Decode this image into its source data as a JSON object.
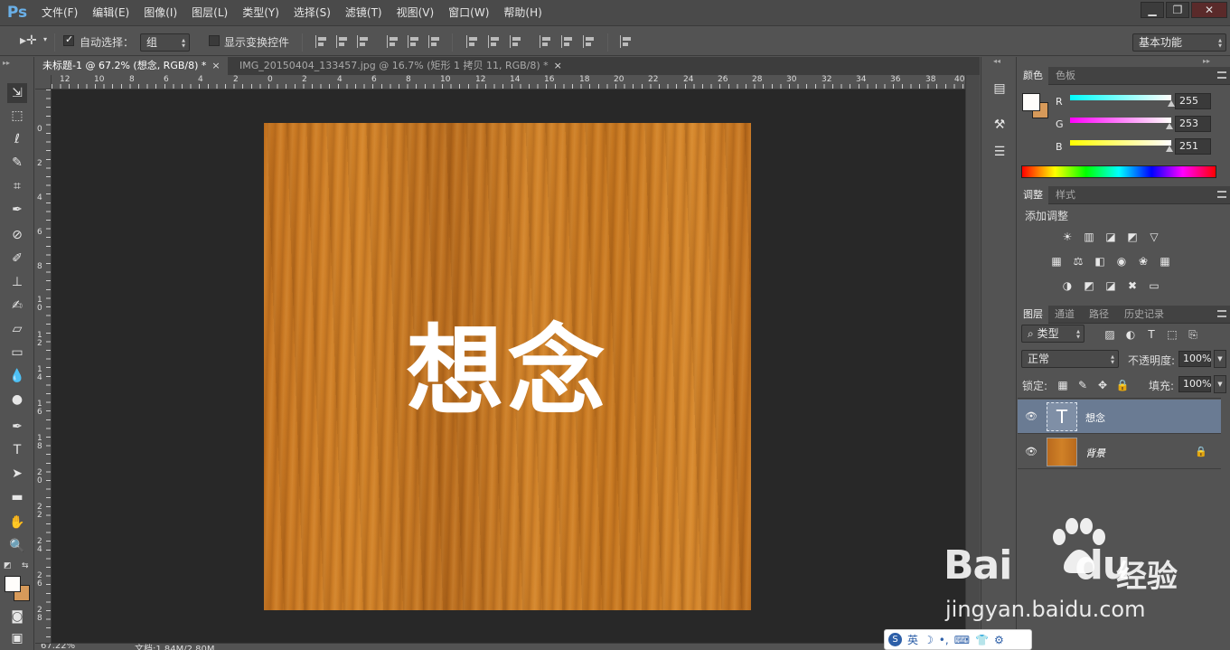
{
  "app": {
    "logo": "Ps"
  },
  "menu": [
    "文件(F)",
    "编辑(E)",
    "图像(I)",
    "图层(L)",
    "类型(Y)",
    "选择(S)",
    "滤镜(T)",
    "视图(V)",
    "窗口(W)",
    "帮助(H)"
  ],
  "window_buttons": {
    "minimize": "▁",
    "restore": "❐",
    "close": "✕"
  },
  "options": {
    "auto_select_label": "自动选择：",
    "auto_select_checked": true,
    "auto_select_target": "组",
    "show_transform_label": "显示变换控件",
    "show_transform_checked": false,
    "workspace": "基本功能"
  },
  "tabs": [
    {
      "label": "未标题-1 @ 67.2% (想念, RGB/8) *",
      "active": true
    },
    {
      "label": "IMG_20150404_133457.jpg @ 16.7% (矩形 1 拷贝 11, RGB/8) *",
      "active": false
    }
  ],
  "ruler": {
    "h_labels": [
      "12",
      "10",
      "8",
      "6",
      "4",
      "2",
      "0",
      "2",
      "4",
      "6",
      "8",
      "10",
      "12",
      "14",
      "16",
      "18",
      "20",
      "22",
      "24",
      "26",
      "28",
      "30",
      "32",
      "34",
      "36",
      "38",
      "40"
    ],
    "v_labels": [
      "0",
      "2",
      "4",
      "6",
      "8",
      "10",
      "12",
      "14",
      "16",
      "18",
      "20",
      "22",
      "24",
      "26",
      "28"
    ]
  },
  "document": {
    "text": "想念"
  },
  "status": {
    "zoom": "67.22%",
    "doc_info": "文档:1.84M/2.80M"
  },
  "color_panel": {
    "tabs": [
      "颜色",
      "色板"
    ],
    "r": {
      "label": "R",
      "value": "255"
    },
    "g": {
      "label": "G",
      "value": "253"
    },
    "b": {
      "label": "B",
      "value": "251"
    },
    "foreground": "#fffdfb",
    "background": "#d79a5a"
  },
  "adjust_panel": {
    "tabs": [
      "调整",
      "样式"
    ],
    "heading": "添加调整",
    "icons": [
      [
        "brightness-icon",
        "levels-icon",
        "curves-icon",
        "exposure-icon",
        "vibrance-icon"
      ],
      [
        "hue-saturation-icon",
        "color-balance-icon",
        "black-white-icon",
        "photo-filter-icon",
        "channel-mixer-icon",
        "color-lookup-icon"
      ],
      [
        "invert-icon",
        "posterize-icon",
        "threshold-icon",
        "selective-color-icon",
        "gradient-map-icon"
      ]
    ]
  },
  "layers_panel": {
    "tabs": [
      "图层",
      "通道",
      "路径",
      "历史记录"
    ],
    "filter_kind": "类型",
    "blend_mode": "正常",
    "opacity_label": "不透明度:",
    "opacity": "100%",
    "lock_label": "锁定:",
    "fill_label": "填充:",
    "fill": "100%",
    "layers": [
      {
        "name": "想念",
        "type": "text",
        "selected": true
      },
      {
        "name": "背景",
        "type": "image",
        "selected": false,
        "locked": true
      }
    ]
  },
  "watermark": {
    "brand": "Bai",
    "brand2": "du",
    "suffix": "经验",
    "url": "jingyan.baidu.com"
  },
  "ime": {
    "mode": "英"
  }
}
